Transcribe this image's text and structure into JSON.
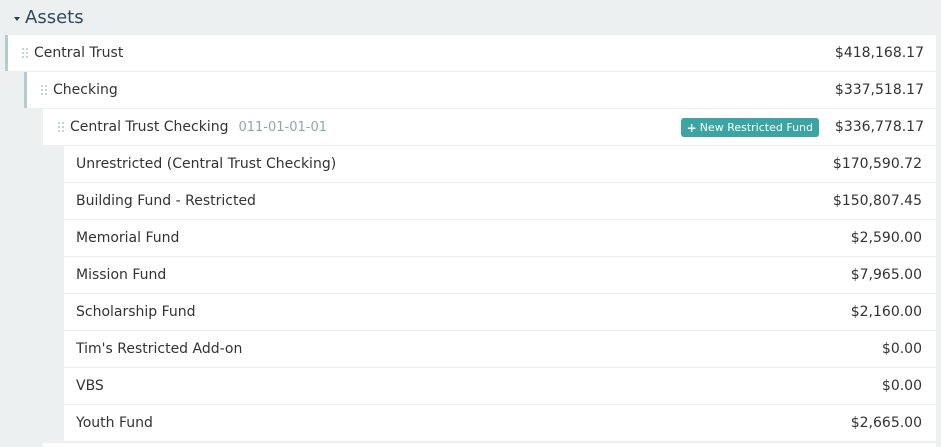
{
  "section": {
    "title": "Assets"
  },
  "accounts": [
    {
      "label": "Central Trust",
      "amount": "$418,168.17"
    },
    {
      "label": "Checking",
      "amount": "$337,518.17"
    },
    {
      "label": "Central Trust Checking",
      "code": "011-01-01-01",
      "amount": "$336,778.17",
      "button": "New Restricted Fund"
    }
  ],
  "funds": [
    {
      "label": "Unrestricted (Central Trust Checking)",
      "amount": "$170,590.72"
    },
    {
      "label": "Building Fund - Restricted",
      "amount": "$150,807.45"
    },
    {
      "label": "Memorial Fund",
      "amount": "$2,590.00"
    },
    {
      "label": "Mission Fund",
      "amount": "$7,965.00"
    },
    {
      "label": "Scholarship Fund",
      "amount": "$2,160.00"
    },
    {
      "label": "Tim's Restricted Add-on",
      "amount": "$0.00"
    },
    {
      "label": "VBS",
      "amount": "$0.00"
    },
    {
      "label": "Youth Fund",
      "amount": "$2,665.00"
    }
  ]
}
